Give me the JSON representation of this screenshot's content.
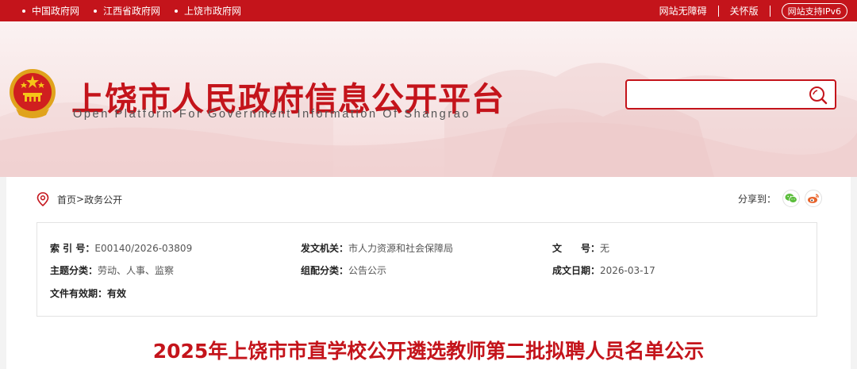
{
  "topbar": {
    "links": [
      "中国政府网",
      "江西省政府网",
      "上饶市政府网"
    ],
    "accessibility": "网站无障碍",
    "care_mode": "关怀版",
    "ipv6": "网站支持IPv6"
  },
  "header": {
    "title": "上饶市人民政府信息公开平台",
    "subtitle": "Open Platform For Government Information Of Shangrao",
    "search_placeholder": ""
  },
  "breadcrumb": {
    "home": "首页",
    "separator": ">",
    "current": "政务公开"
  },
  "share": {
    "label": "分享到：",
    "icons": [
      "wechat-icon",
      "weibo-icon"
    ]
  },
  "meta": {
    "index_no_label": "索 引 号：",
    "index_no": "E00140/2026-03809",
    "issuer_label": "发文机关：",
    "issuer": "市人力资源和社会保障局",
    "doc_no_label": "文　　号：",
    "doc_no": "无",
    "topic_label": "主题分类：",
    "topic": "劳动、人事、监察",
    "category_label": "组配分类：",
    "category": "公告公示",
    "date_label": "成文日期：",
    "date": "2026-03-17",
    "validity_label": "文件有效期：",
    "validity": "有效"
  },
  "document": {
    "title": "2025年上饶市市直学校公开遴选教师第二批拟聘人员名单公示"
  },
  "colors": {
    "brand_red": "#c4141b",
    "wechat_green": "#5bbd3b",
    "weibo_orange": "#e8632b"
  }
}
